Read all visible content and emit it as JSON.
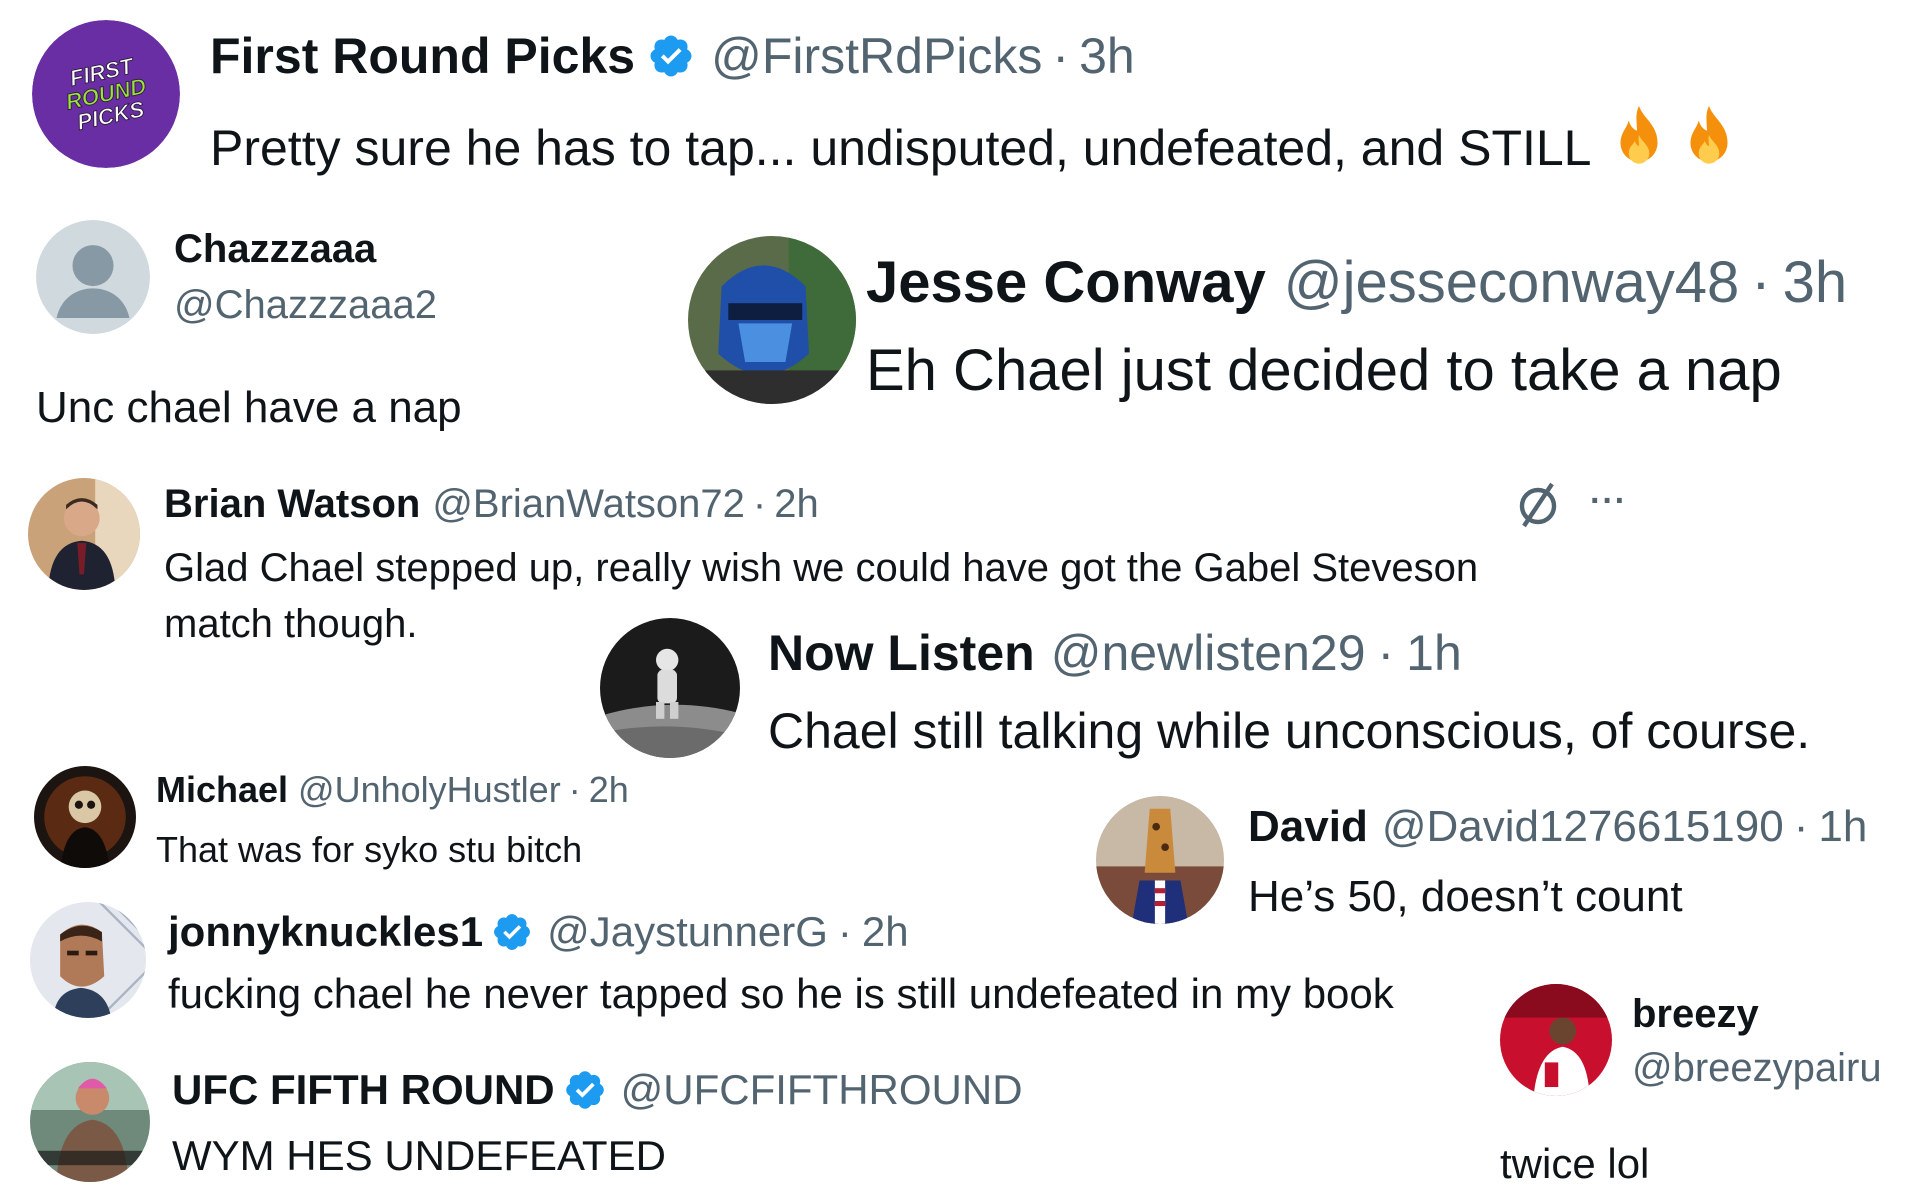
{
  "colors": {
    "verified": "#1d9bf0",
    "handle": "#536471",
    "text": "#0f1419",
    "fire": "#f4900c",
    "firstRoundBg": "#6a2ea4",
    "firstRoundAccent": "#9be33b"
  },
  "tweets": [
    {
      "name": "First Round Picks",
      "verified": true,
      "handle": "@FirstRdPicks",
      "sep": "·",
      "time": "3h",
      "text": "Pretty sure he has to tap... undisputed, undefeated, and STILL",
      "emoji": [
        "fire-emoji",
        "fire-emoji"
      ],
      "avatar_text": [
        "FIRST",
        "ROUND",
        "PICKS"
      ]
    },
    {
      "name": "Chazzzaaa",
      "handle": "@Chazzzaaa2",
      "text": "Unc chael have a nap"
    },
    {
      "name": "Jesse Conway",
      "handle": "@jesseconway48",
      "sep": "·",
      "time": "3h",
      "text": "Eh Chael just decided to take a nap"
    },
    {
      "name": "Brian Watson",
      "handle": "@BrianWatson72",
      "sep": "·",
      "time": "2h",
      "text_line1": "Glad Chael stepped up, really wish we could have got the Gabel Steveson",
      "text_line2": "match though.",
      "more": "···"
    },
    {
      "name": "Now Listen",
      "handle": "@newlisten29",
      "sep": "·",
      "time": "1h",
      "text": "Chael still talking while unconscious, of course."
    },
    {
      "name": "Michael",
      "handle": "@UnholyHustler",
      "sep": "·",
      "time": "2h",
      "text": "That was for syko stu bitch"
    },
    {
      "name": "David",
      "handle": "@David1276615190",
      "sep": "·",
      "time": "1h",
      "text": "He’s 50, doesn’t count"
    },
    {
      "name": "jonnyknuckles1",
      "verified": true,
      "handle": "@JaystunnerG",
      "sep": "·",
      "time": "2h",
      "text": "fucking chael he never tapped so  he is still undefeated in my book"
    },
    {
      "name": "breezy",
      "handle": "@breezypairu",
      "text": "twice lol"
    },
    {
      "name": "UFC FIFTH ROUND",
      "verified": true,
      "handle": "@UFCFIFTHROUND",
      "text": "WYM HES UNDEFEATED"
    }
  ]
}
